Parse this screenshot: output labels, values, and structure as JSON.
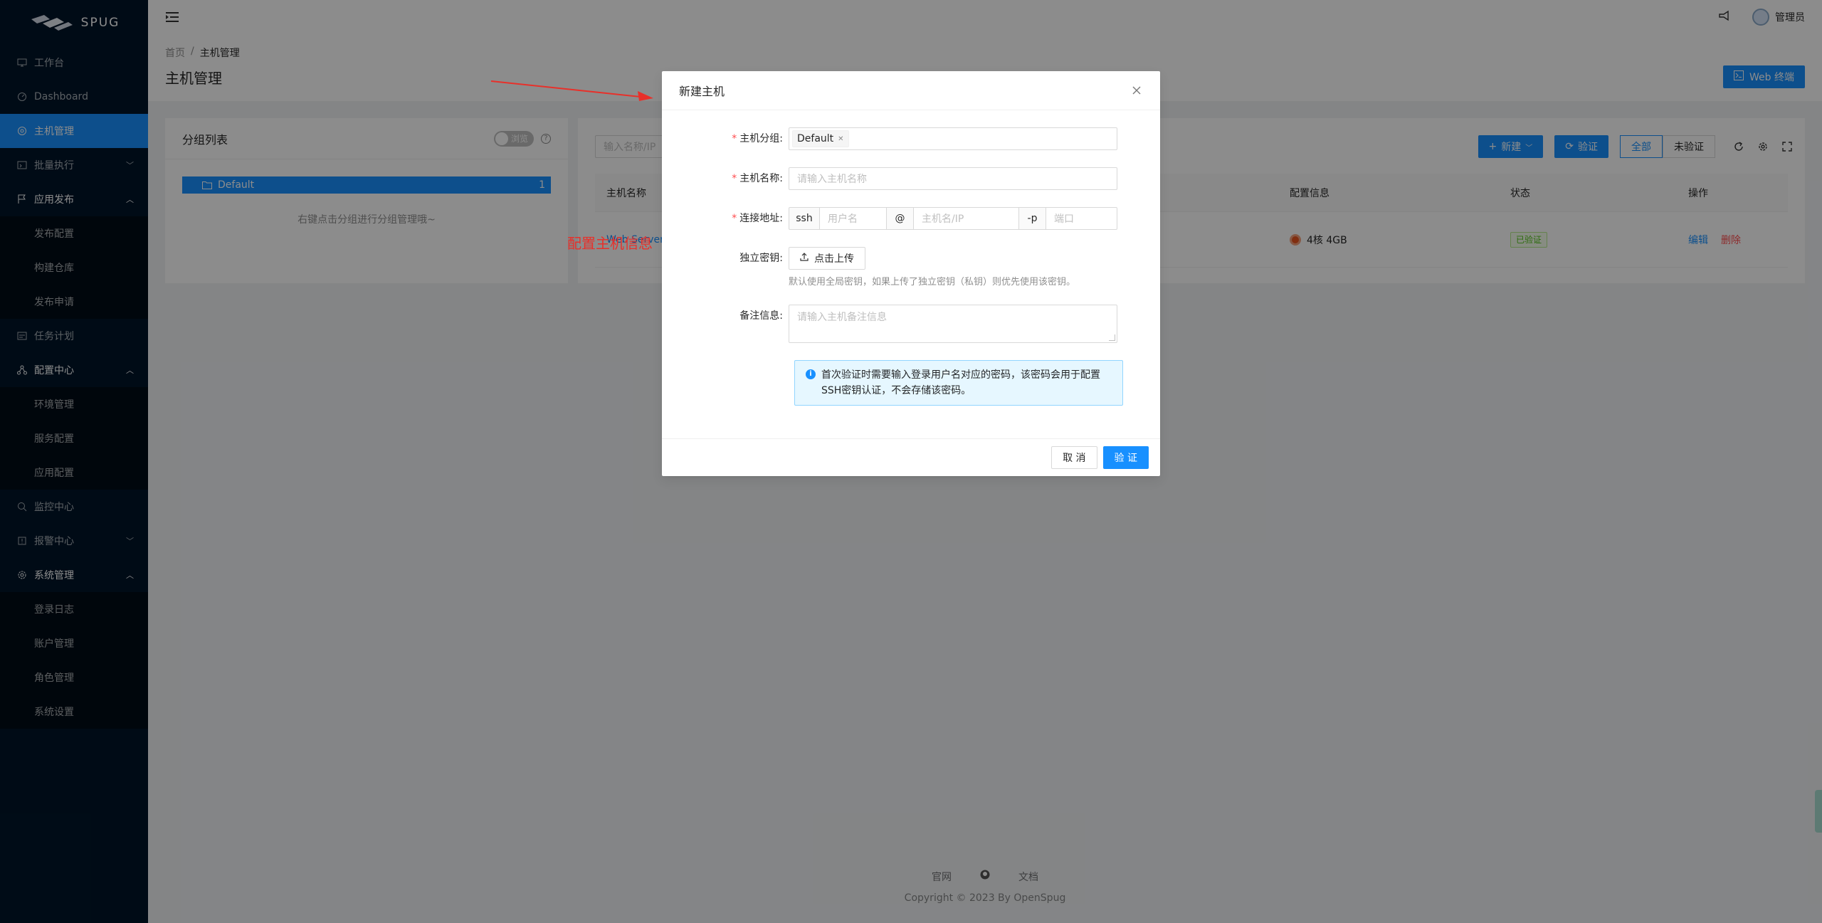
{
  "app": {
    "logo_text": "SPUG"
  },
  "sidebar": {
    "items": [
      {
        "label": "工作台",
        "icon": "desktop-icon"
      },
      {
        "label": "Dashboard",
        "icon": "dashboard-icon"
      },
      {
        "label": "主机管理",
        "icon": "cloud-server-icon",
        "active": true
      },
      {
        "label": "批量执行",
        "icon": "code-icon",
        "arrow": "﹀"
      },
      {
        "label": "应用发布",
        "icon": "flag-icon",
        "arrow": "︿"
      },
      {
        "label": "发布配置",
        "sub": true
      },
      {
        "label": "构建仓库",
        "sub": true
      },
      {
        "label": "发布申请",
        "sub": true
      },
      {
        "label": "任务计划",
        "icon": "schedule-icon"
      },
      {
        "label": "配置中心",
        "icon": "deployment-icon",
        "arrow": "︿"
      },
      {
        "label": "环境管理",
        "sub": true
      },
      {
        "label": "服务配置",
        "sub": true
      },
      {
        "label": "应用配置",
        "sub": true
      },
      {
        "label": "监控中心",
        "icon": "monitor-icon"
      },
      {
        "label": "报警中心",
        "icon": "alert-icon",
        "arrow": "﹀"
      },
      {
        "label": "系统管理",
        "icon": "setting-icon",
        "arrow": "︿"
      },
      {
        "label": "登录日志",
        "sub": true
      },
      {
        "label": "账户管理",
        "sub": true
      },
      {
        "label": "角色管理",
        "sub": true
      },
      {
        "label": "系统设置",
        "sub": true
      }
    ]
  },
  "header": {
    "username": "管理员"
  },
  "page": {
    "breadcrumb": [
      "首页",
      "主机管理"
    ],
    "title": "主机管理",
    "web_terminal_label": "Web 终端"
  },
  "groups": {
    "title": "分组列表",
    "switch_label": "浏览",
    "node_label": "Default",
    "node_count": "1",
    "hint": "右键点击分组进行分组管理哦~"
  },
  "hosts": {
    "search_placeholder": "输入名称/IP",
    "new_label": "新建",
    "verify_label": "验证",
    "filter_all": "全部",
    "filter_unverified": "未验证",
    "columns": {
      "name": "主机名称",
      "config": "配置信息",
      "status": "状态",
      "ops": "操作"
    },
    "rows": [
      {
        "name": "Web Server",
        "config": "4核 4GB",
        "status": "已验证",
        "edit": "编辑",
        "delete": "删除"
      }
    ]
  },
  "annotation": {
    "text": "配置主机信息",
    "color": "#e8302a"
  },
  "modal": {
    "title": "新建主机",
    "fields": {
      "group_label": "主机分组:",
      "group_tag": "Default",
      "name_label": "主机名称:",
      "name_placeholder": "请输入主机名称",
      "addr_label": "连接地址:",
      "ssh_addon": "ssh",
      "user_placeholder": "用户名",
      "at_addon": "@",
      "host_placeholder": "主机名/IP",
      "port_addon": "-p",
      "port_placeholder": "端口",
      "key_label": "独立密钥:",
      "upload_label": "点击上传",
      "key_extra": "默认使用全局密钥，如果上传了独立密钥（私钥）则优先使用该密钥。",
      "desc_label": "备注信息:",
      "desc_placeholder": "请输入主机备注信息"
    },
    "alert_line1": "首次验证时需要输入登录用户名对应的密码，该密码会用于配置",
    "alert_line2": "SSH密钥认证，不会存储该密码。",
    "cancel_label": "取 消",
    "ok_label": "验 证"
  },
  "footer": {
    "links": [
      "官网",
      "文档"
    ],
    "copyright": "Copyright © 2023 By OpenSpug"
  },
  "colors": {
    "primary": "#1890ff",
    "sidebar": "#001529",
    "danger": "#ff4d4f"
  }
}
